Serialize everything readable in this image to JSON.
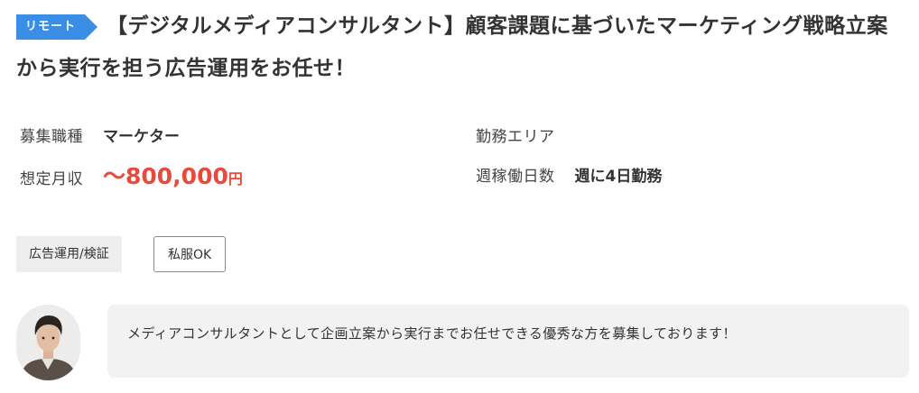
{
  "job": {
    "badge": "リモート",
    "title": "【デジタルメディアコンサルタント】顧客課題に基づいたマーケティング戦略立案から実行を担う広告運用をお任せ！"
  },
  "details": {
    "category_label": "募集職種",
    "category_value": "マーケター",
    "area_label": "勤務エリア",
    "salary_label": "想定月収",
    "salary_value": "〜800,000",
    "salary_unit": "円",
    "workdays_label": "週稼働日数",
    "workdays_value": "週に4日勤務"
  },
  "tags": [
    "広告運用/検証",
    "私服OK"
  ],
  "recruiter": {
    "message": "メディアコンサルタントとして企画立案から実行までお任せできる優秀な方を募集しております！"
  },
  "colors": {
    "badge": "#3a8ee6",
    "salary": "#e84a3c"
  }
}
